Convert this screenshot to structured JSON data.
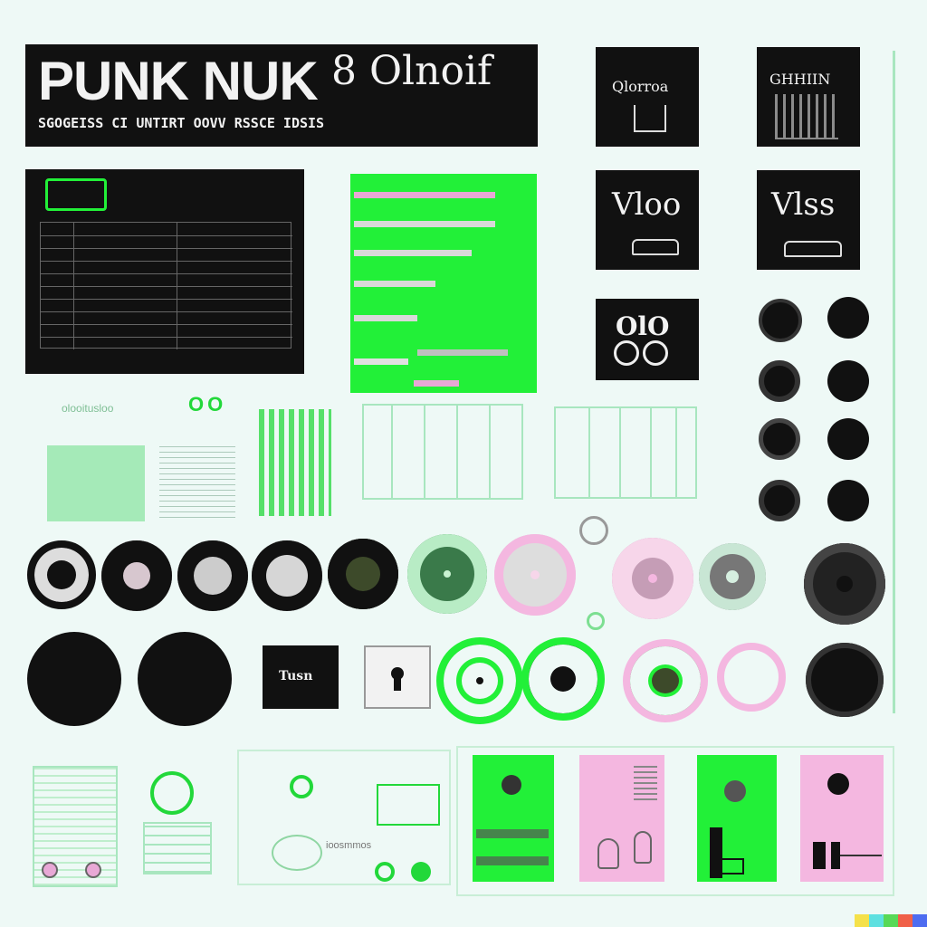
{
  "header": {
    "title": "PUNK NUK",
    "brand": "8 Olnoif",
    "subtitle": "SGOGEISS CI UNTIRT OOVV RSSCE IDSIS"
  },
  "thumbs": [
    {
      "label": "Qlorroa"
    },
    {
      "label": "GHHIIN"
    },
    {
      "label": "Vloo"
    },
    {
      "label": "Vlss"
    },
    {
      "label": "OlO"
    }
  ],
  "small_texts": {
    "green_caption": "olooitusloo",
    "oo_mark": "OO",
    "panel_label": "ioosmmos",
    "key_label": "Tusn"
  },
  "colors": {
    "accent_green": "#22f038",
    "accent_pink": "#f4b7e0",
    "dark": "#111111",
    "background": "#eef9f6"
  }
}
